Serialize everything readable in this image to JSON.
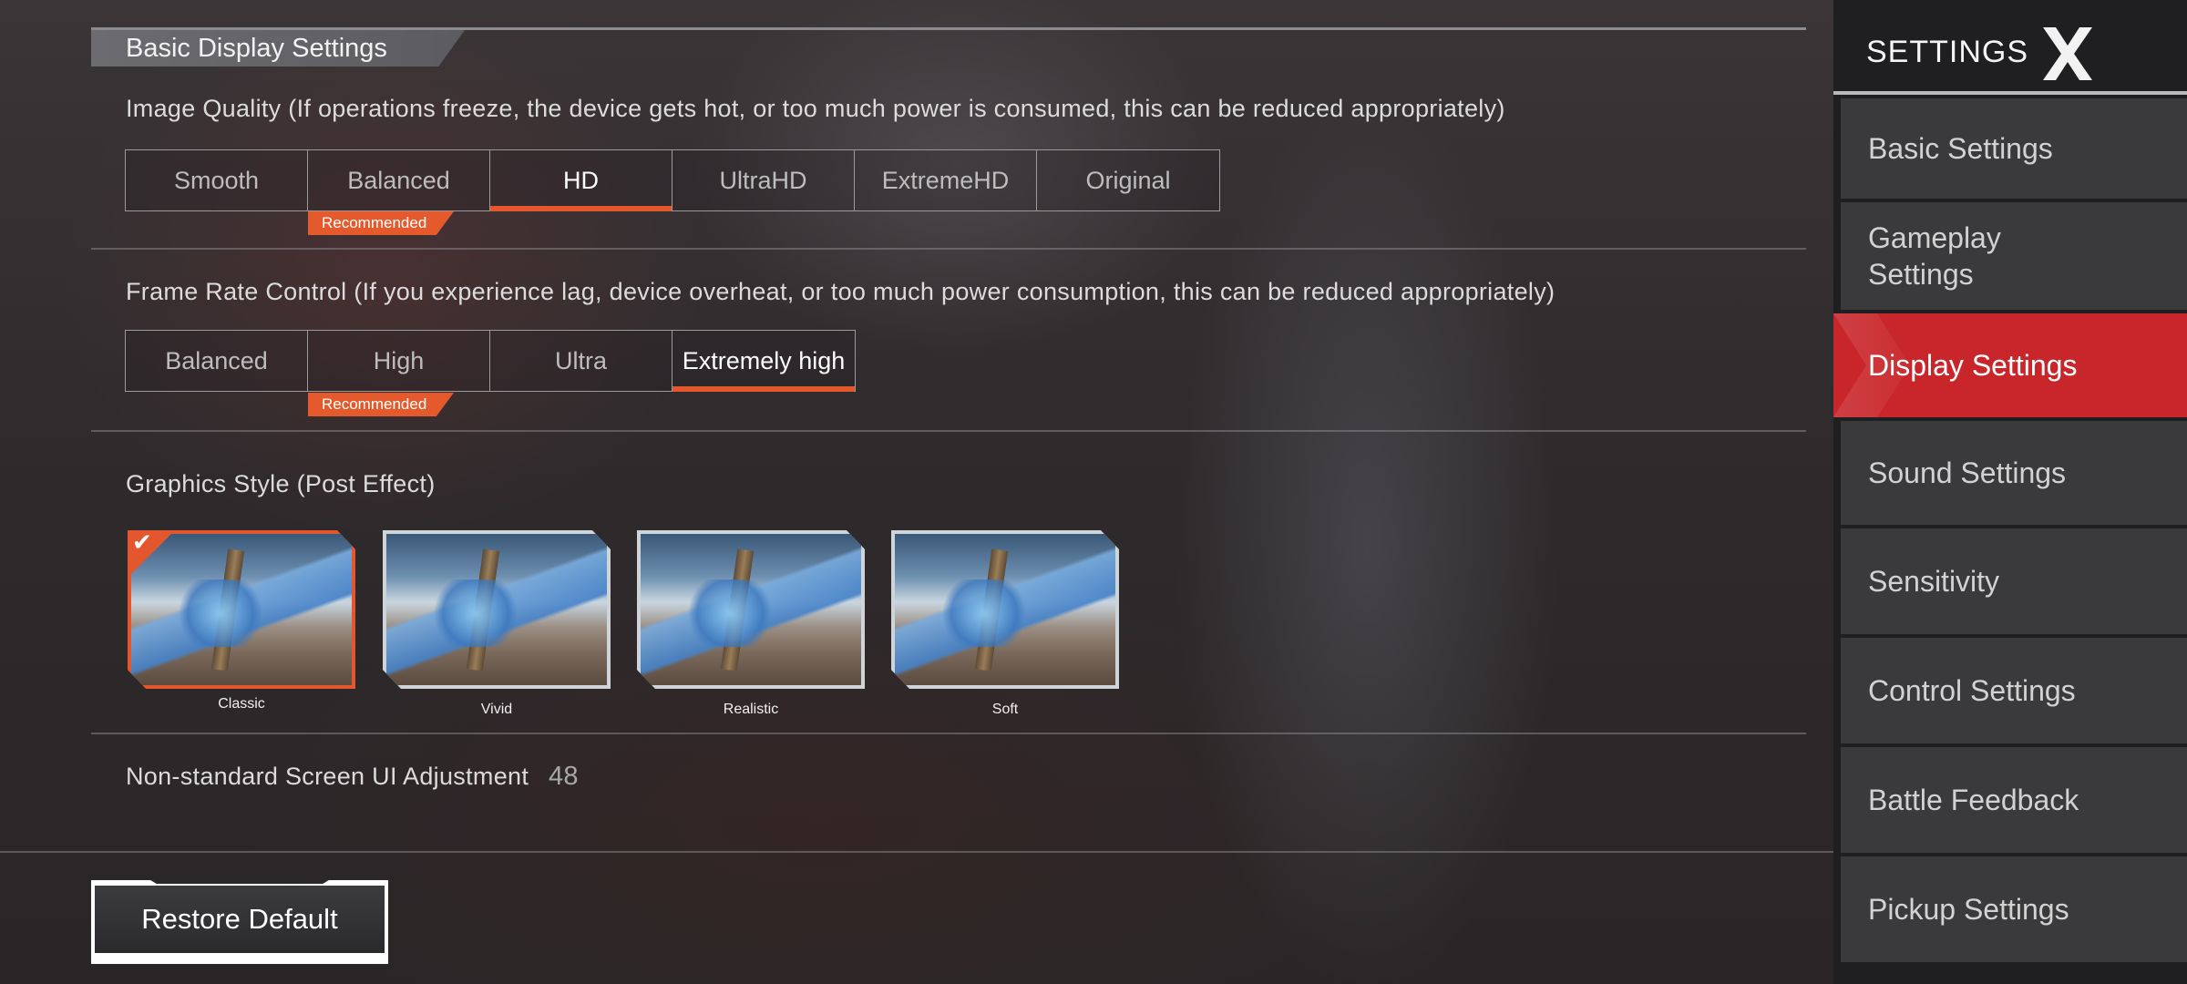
{
  "main": {
    "section_title": "Basic Display Settings",
    "image_quality": {
      "label": "Image Quality (If operations freeze, the device gets hot, or too much power is consumed, this can be reduced appropriately)",
      "options": [
        "Smooth",
        "Balanced",
        "HD",
        "UltraHD",
        "ExtremeHD",
        "Original"
      ],
      "selected": "HD",
      "recommended": "Balanced",
      "recommended_label": "Recommended"
    },
    "frame_rate": {
      "label": "Frame Rate Control (If you experience lag, device overheat, or too much power consumption, this can be reduced appropriately)",
      "options": [
        "Balanced",
        "High",
        "Ultra",
        "Extremely high"
      ],
      "selected": "Extremely high",
      "recommended": "High",
      "recommended_label": "Recommended"
    },
    "graphics_style": {
      "label": "Graphics Style (Post Effect)",
      "options": [
        "Classic",
        "Vivid",
        "Realistic",
        "Soft"
      ],
      "selected": "Classic"
    },
    "ui_adjustment": {
      "label": "Non-standard Screen UI Adjustment",
      "value": "48"
    },
    "restore_label": "Restore Default"
  },
  "sidebar": {
    "title": "SETTINGS",
    "close_icon": "close-x-icon",
    "items": [
      {
        "label": "Basic Settings"
      },
      {
        "label": "Gameplay Settings"
      },
      {
        "label": "Display Settings",
        "active": true
      },
      {
        "label": "Sound Settings"
      },
      {
        "label": "Sensitivity"
      },
      {
        "label": "Control Settings"
      },
      {
        "label": "Battle Feedback"
      },
      {
        "label": "Pickup Settings"
      }
    ]
  },
  "colors": {
    "accent": "#e4572e",
    "active_tab": "#c8262a"
  }
}
